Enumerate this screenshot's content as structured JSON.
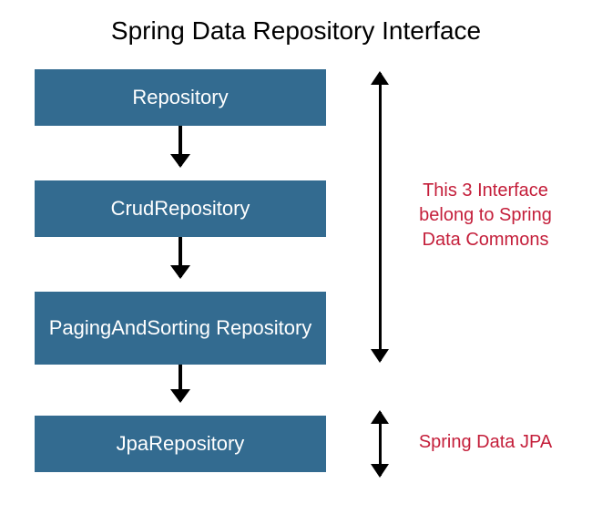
{
  "title": "Spring Data Repository Interface",
  "boxes": {
    "repository": "Repository",
    "crud": "CrudRepository",
    "paging": "PagingAndSorting Repository",
    "jpa": "JpaRepository"
  },
  "annotations": {
    "commons": "This 3 Interface belong to Spring Data Commons",
    "jpa": "Spring Data JPA"
  },
  "colors": {
    "box_bg": "#336b90",
    "box_text": "#ffffff",
    "annotation": "#c41e3a"
  }
}
